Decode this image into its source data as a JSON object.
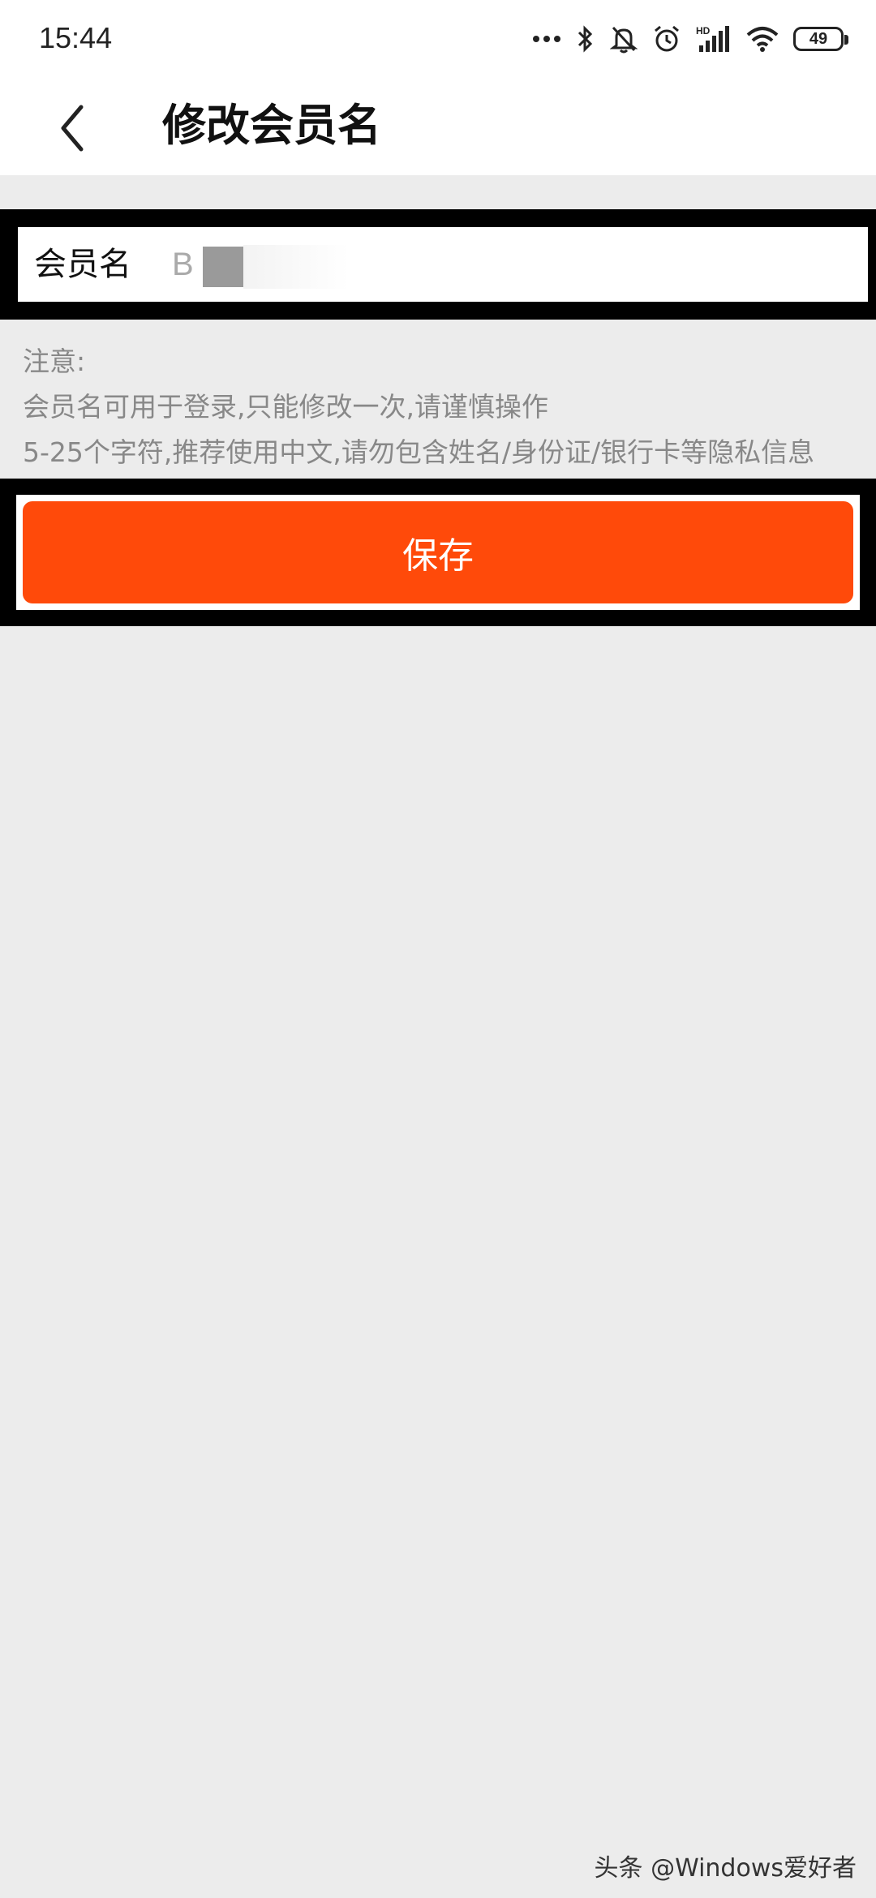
{
  "status_bar": {
    "time": "15:44",
    "battery": "49",
    "icons": [
      "more-dots-icon",
      "bluetooth-icon",
      "bell-off-icon",
      "alarm-icon",
      "hd-signal-icon",
      "wifi-icon",
      "battery-icon"
    ]
  },
  "header": {
    "title": "修改会员名",
    "back_icon": "chevron-left-icon"
  },
  "form": {
    "label": "会员名",
    "value": "B"
  },
  "notes": {
    "title": "注意:",
    "line1": "会员名可用于登录,只能修改一次,请谨慎操作",
    "line2": "5-25个字符,推荐使用中文,请勿包含姓名/身份证/银行卡等隐私信息"
  },
  "save": {
    "label": "保存"
  },
  "colors": {
    "accent": "#ff4a0a",
    "background": "#ececec"
  },
  "watermark": "头条 @Windows爱好者"
}
